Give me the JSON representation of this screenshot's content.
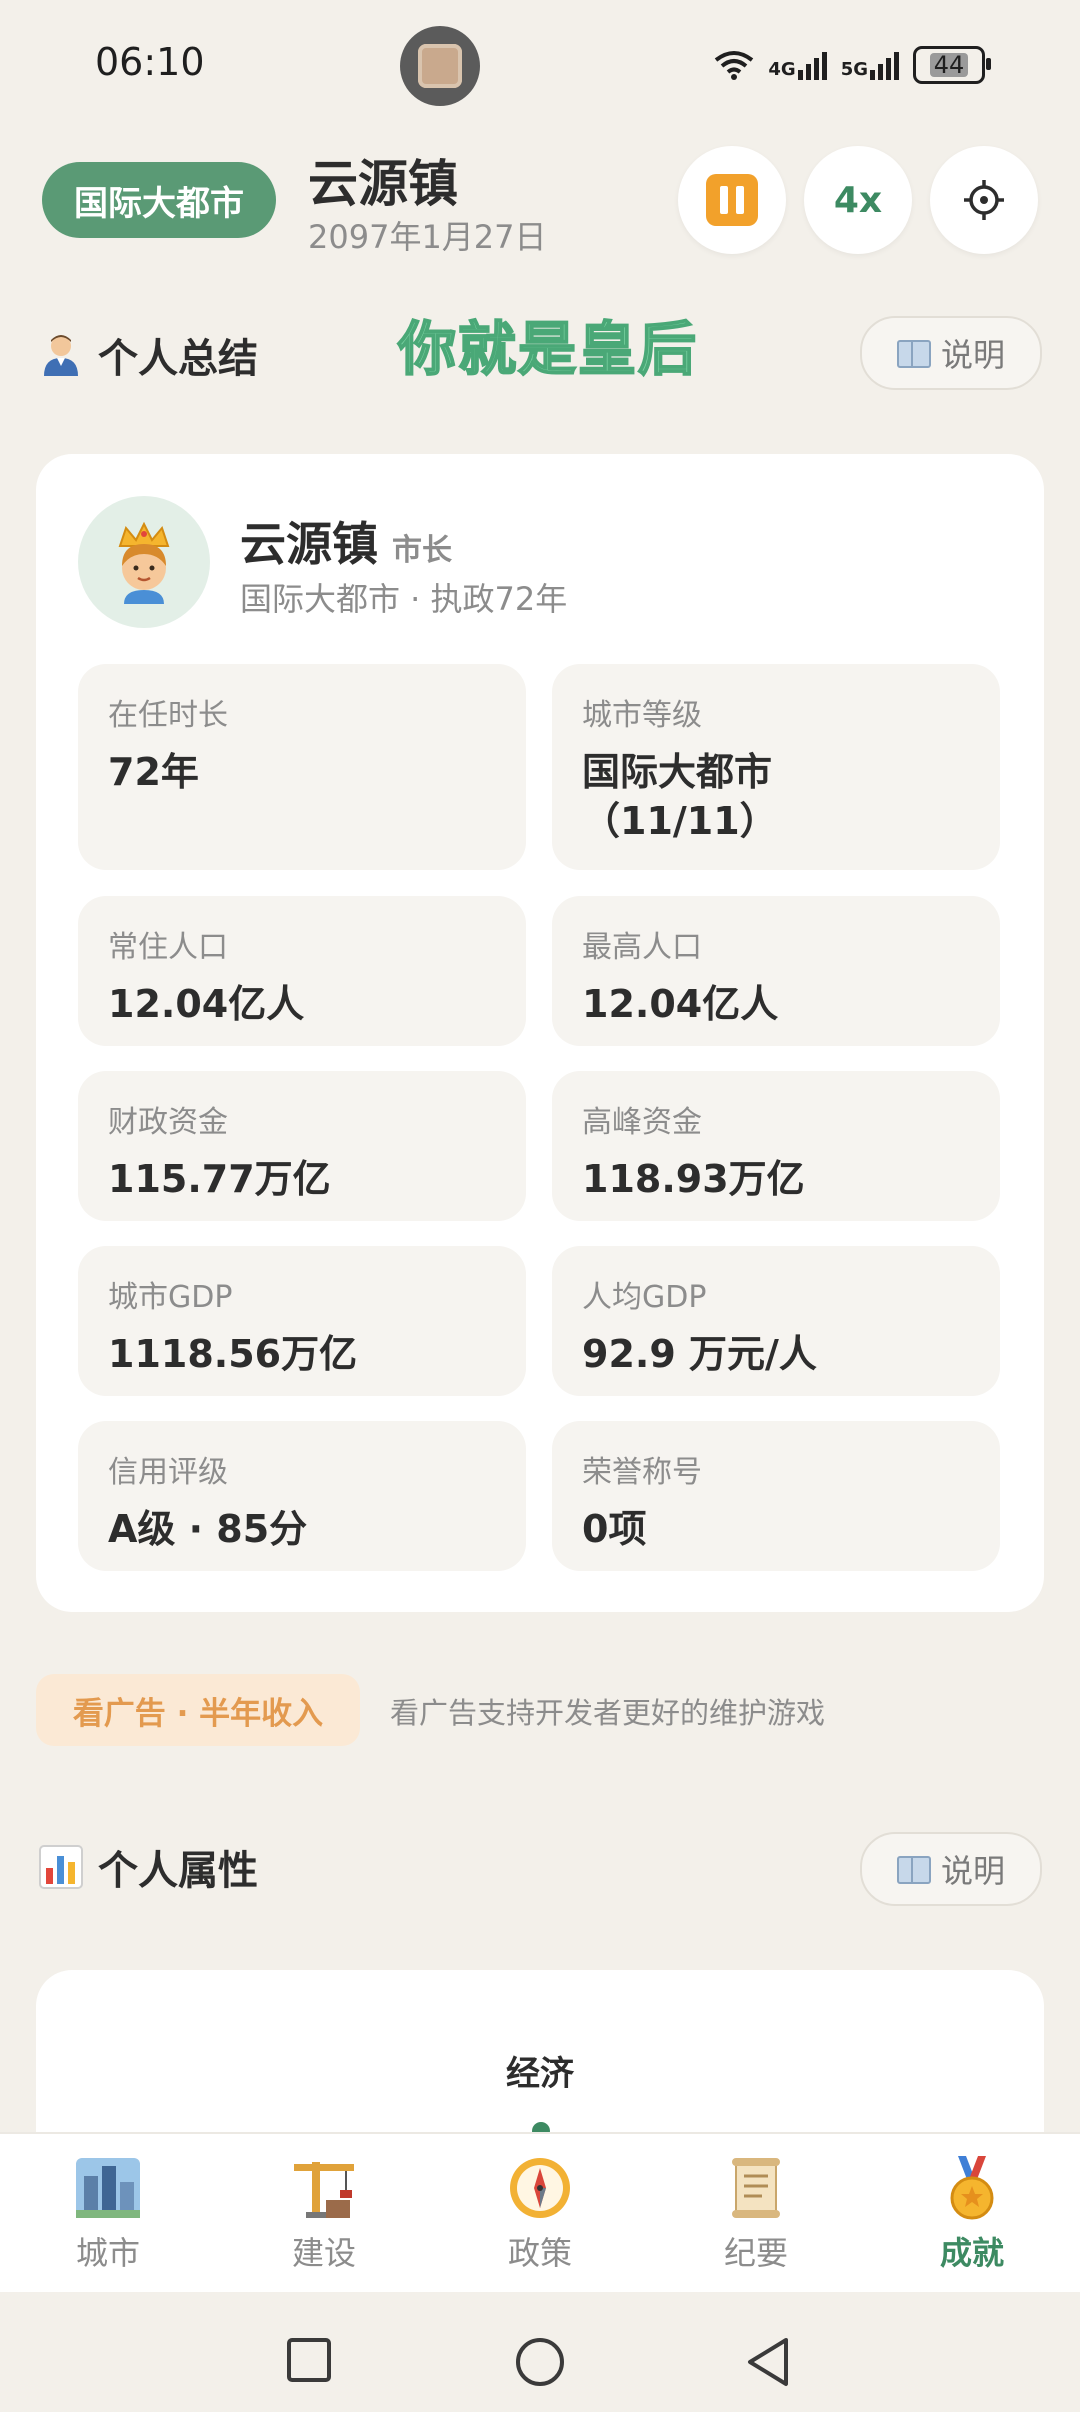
{
  "status_bar": {
    "time": "06:10",
    "network_1": "4G",
    "network_2": "5G",
    "battery": "44"
  },
  "header": {
    "level_badge": "国际大都市",
    "city_name": "云源镇",
    "date": "2097年1月27日",
    "speed": "4x",
    "buttons": [
      "pause-icon",
      "speed",
      "settings-icon"
    ]
  },
  "summary_section": {
    "title": "个人总结",
    "overlay_text": "你就是皇后",
    "explain_label": "说明"
  },
  "profile": {
    "name": "云源镇",
    "role": "市长",
    "subtitle": "国际大都市 · 执政72年"
  },
  "stats": [
    {
      "label": "在任时长",
      "value": "72年"
    },
    {
      "label": "城市等级",
      "value": "国际大都市\n（11/11）"
    },
    {
      "label": "常住人口",
      "value": "12.04亿人"
    },
    {
      "label": "最高人口",
      "value": "12.04亿人"
    },
    {
      "label": "财政资金",
      "value": "115.77万亿"
    },
    {
      "label": "高峰资金",
      "value": "118.93万亿"
    },
    {
      "label": "城市GDP",
      "value": "1118.56万亿"
    },
    {
      "label": "人均GDP",
      "value": "92.9 万元/人"
    },
    {
      "label": "信用评级",
      "value": "A级 · 85分"
    },
    {
      "label": "荣誉称号",
      "value": "0项"
    }
  ],
  "ad": {
    "button_label": "看广告 · 半年收入",
    "note": "看广告支持开发者更好的维护游戏"
  },
  "attributes_section": {
    "title": "个人属性",
    "explain_label": "说明",
    "first_item": "经济"
  },
  "bottom_nav": [
    {
      "label": "城市",
      "icon": "city-icon",
      "active": false
    },
    {
      "label": "建设",
      "icon": "crane-icon",
      "active": false
    },
    {
      "label": "政策",
      "icon": "compass-icon",
      "active": false
    },
    {
      "label": "纪要",
      "icon": "scroll-icon",
      "active": false
    },
    {
      "label": "成就",
      "icon": "medal-icon",
      "active": true
    }
  ],
  "colors": {
    "accent_green": "#3d8a62",
    "pill_green": "#5a9a75",
    "ad_orange": "#e39a4f",
    "background": "#f3f0ea"
  }
}
